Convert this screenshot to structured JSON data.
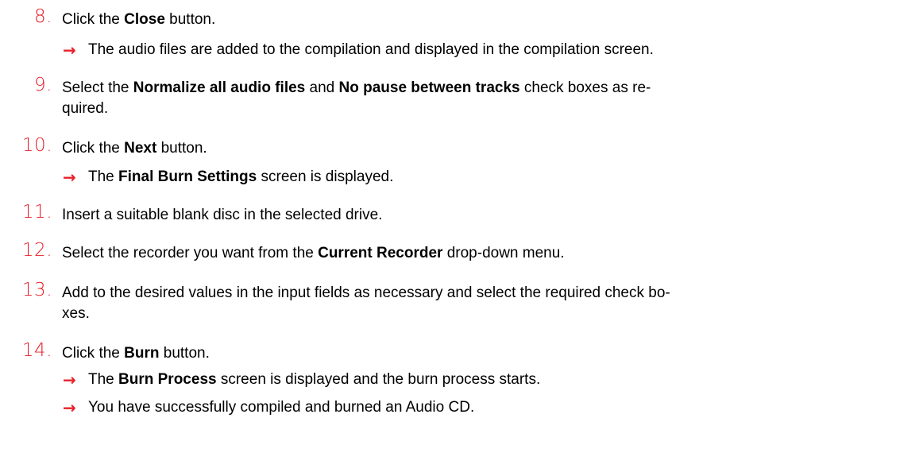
{
  "steps": [
    {
      "number": "8.",
      "parts": [
        {
          "text": "Click the ",
          "bold": false
        },
        {
          "text": "Close",
          "bold": true
        },
        {
          "text": " button.",
          "bold": false
        }
      ],
      "results": [
        [
          {
            "text": "The audio files are added to the compilation and displayed in the compilation screen.",
            "bold": false
          }
        ]
      ]
    },
    {
      "number": "9.",
      "parts": [
        {
          "text": "Select the ",
          "bold": false
        },
        {
          "text": "Normalize all audio files",
          "bold": true
        },
        {
          "text": " and ",
          "bold": false
        },
        {
          "text": "No pause between tracks",
          "bold": true
        },
        {
          "text": " check boxes as re-",
          "bold": false
        },
        {
          "text": "\nquired.",
          "bold": false
        }
      ],
      "results": []
    },
    {
      "number": "10.",
      "parts": [
        {
          "text": "Click the ",
          "bold": false
        },
        {
          "text": "Next",
          "bold": true
        },
        {
          "text": " button.",
          "bold": false
        }
      ],
      "results": [
        [
          {
            "text": "The ",
            "bold": false
          },
          {
            "text": "Final Burn Settings",
            "bold": true
          },
          {
            "text": " screen is displayed.",
            "bold": false
          }
        ]
      ]
    },
    {
      "number": "11.",
      "parts": [
        {
          "text": "Insert a suitable blank disc in the selected drive.",
          "bold": false
        }
      ],
      "results": []
    },
    {
      "number": "12.",
      "parts": [
        {
          "text": "Select the recorder you want from the ",
          "bold": false
        },
        {
          "text": "Current Recorder",
          "bold": true
        },
        {
          "text": " drop-down menu.",
          "bold": false
        }
      ],
      "results": []
    },
    {
      "number": "13.",
      "parts": [
        {
          "text": "Add to the desired values in the input fields as necessary and select the required check bo-",
          "bold": false
        },
        {
          "text": "\nxes.",
          "bold": false
        }
      ],
      "results": []
    },
    {
      "number": "14.",
      "parts": [
        {
          "text": "Click the ",
          "bold": false
        },
        {
          "text": "Burn",
          "bold": true
        },
        {
          "text": " button.",
          "bold": false
        }
      ],
      "results": [
        [
          {
            "text": "The ",
            "bold": false
          },
          {
            "text": "Burn Process",
            "bold": true
          },
          {
            "text": " screen is displayed and the burn process starts.",
            "bold": false
          }
        ],
        [
          {
            "text": "You have successfully compiled and burned an Audio CD.",
            "bold": false
          }
        ]
      ]
    }
  ],
  "icons": {
    "result_arrow": "right-arrow-icon",
    "accent_color": "#e8202a"
  }
}
